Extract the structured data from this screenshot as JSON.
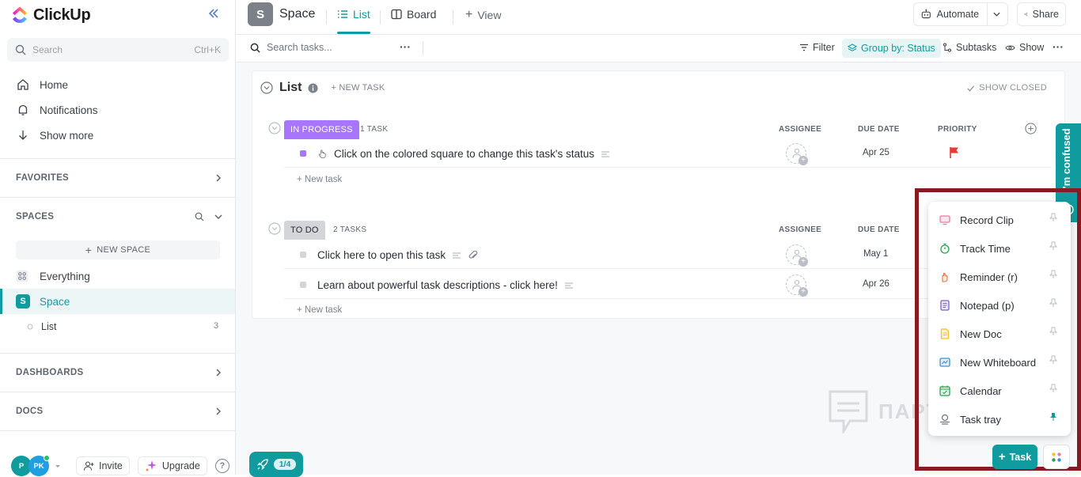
{
  "app": {
    "name": "ClickUp"
  },
  "sidebar": {
    "search_placeholder": "Search",
    "search_shortcut": "Ctrl+K",
    "nav": [
      {
        "label": "Home",
        "icon": "home-icon"
      },
      {
        "label": "Notifications",
        "icon": "bell-icon"
      },
      {
        "label": "Show more",
        "icon": "arrow-down-icon"
      }
    ],
    "favorites_label": "FAVORITES",
    "spaces_label": "SPACES",
    "new_space_label": "NEW SPACE",
    "everything_label": "Everything",
    "space_label": "Space",
    "space_initial": "S",
    "list_label": "List",
    "list_count": "3",
    "dashboards_label": "DASHBOARDS",
    "docs_label": "DOCS",
    "avatar_1": "P",
    "avatar_2": "PK",
    "invite_label": "Invite",
    "upgrade_label": "Upgrade",
    "help_label": "?"
  },
  "header": {
    "space_initial": "S",
    "space_title": "Space",
    "tabs": [
      {
        "label": "List",
        "active": true
      },
      {
        "label": "Board",
        "active": false
      },
      {
        "label": "View",
        "active": false
      }
    ],
    "automate_label": "Automate",
    "share_label": "Share"
  },
  "toolbar": {
    "search_placeholder": "Search tasks...",
    "more_label": "···",
    "filter_label": "Filter",
    "group_label": "Group by: Status",
    "subtasks_label": "Subtasks",
    "show_label": "Show",
    "options_label": "···"
  },
  "list": {
    "title": "List",
    "new_task_label": "+ NEW TASK",
    "show_closed_label": "SHOW CLOSED",
    "columns": {
      "assignee": "ASSIGNEE",
      "due_date": "DUE DATE",
      "priority": "PRIORITY"
    },
    "groups": [
      {
        "status": "IN PROGRESS",
        "count": "1 TASK",
        "color": "#a875ff",
        "tasks": [
          {
            "name": "Click on the colored square to change this task's status",
            "due": "Apr 25",
            "priority_color": "#e53935"
          }
        ],
        "new_task_label": "+ New task"
      },
      {
        "status": "TO DO",
        "count": "2 TASKS",
        "color": "#d3d5d9",
        "tasks": [
          {
            "name": "Click here to open this task",
            "due": "May 1"
          },
          {
            "name": "Learn about powerful task descriptions - click here!",
            "due": "Apr 26"
          }
        ],
        "new_task_label": "+ New task"
      }
    ]
  },
  "feedback_tab": {
    "label": "I'm confused"
  },
  "tray": {
    "items": [
      {
        "label": "Record Clip",
        "icon": "record-clip-icon",
        "color": "#e57ea0"
      },
      {
        "label": "Track Time",
        "icon": "stopwatch-icon",
        "color": "#2ba24c"
      },
      {
        "label": "Reminder (r)",
        "icon": "reminder-hand-icon",
        "color": "#e8734a"
      },
      {
        "label": "Notepad (p)",
        "icon": "notepad-icon",
        "color": "#7b5fc9"
      },
      {
        "label": "New Doc",
        "icon": "doc-icon",
        "color": "#f2c230"
      },
      {
        "label": "New Whiteboard",
        "icon": "whiteboard-icon",
        "color": "#3c8fd6"
      },
      {
        "label": "Calendar",
        "icon": "calendar-icon",
        "color": "#2ba24c"
      },
      {
        "label": "Task tray",
        "icon": "task-tray-icon",
        "color": "#6d7480"
      }
    ]
  },
  "fab": {
    "task_label": "Task"
  },
  "onboarding": {
    "progress": "1/4"
  },
  "watermark": {
    "text": "ПАРТНЕРКИН"
  },
  "colors": {
    "accent": "#109c9e",
    "highlight": "#8a1a22"
  }
}
